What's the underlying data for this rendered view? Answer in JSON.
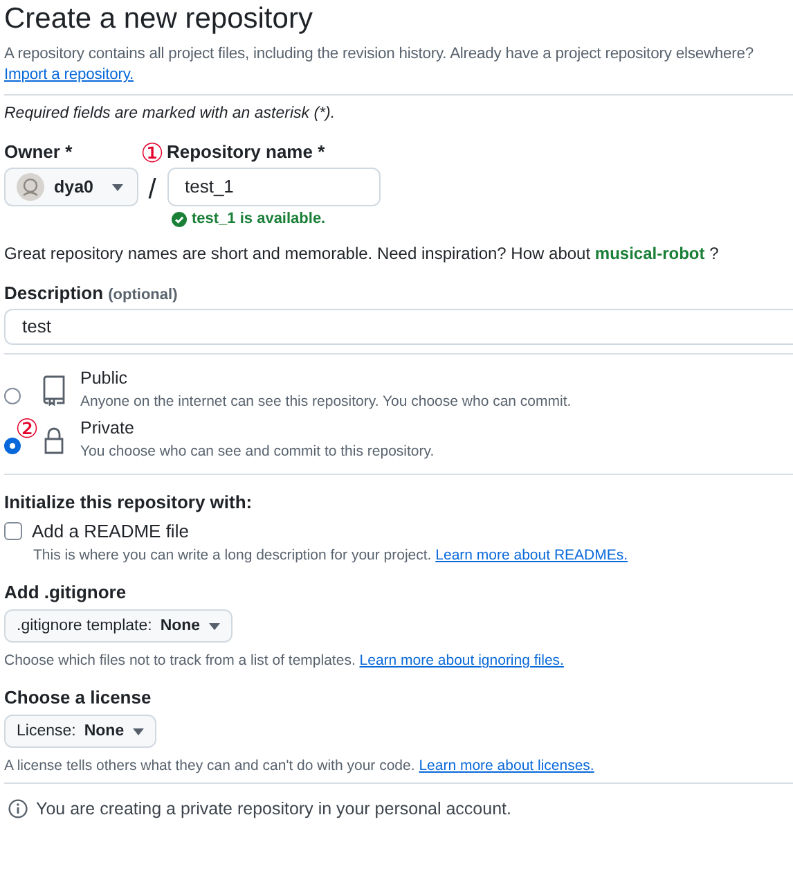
{
  "title": "Create a new repository",
  "intro": {
    "text": "A repository contains all project files, including the revision history. Already have a project repository elsewhere?",
    "link": "Import a repository."
  },
  "required_note": "Required fields are marked with an asterisk (*).",
  "owner": {
    "label": "Owner *",
    "value": "dya0"
  },
  "separator": "/",
  "markers": [
    "①",
    "②"
  ],
  "repo_name": {
    "label": "Repository name *",
    "value": "test_1",
    "status": "test_1 is available."
  },
  "suggestion": {
    "text": "Great repository names are short and memorable. Need inspiration? How about",
    "name": "musical-robot",
    "after": "?"
  },
  "description": {
    "label": "Description",
    "hint": "(optional)",
    "value": "test"
  },
  "visibility": [
    {
      "kind": "public",
      "title": "Public",
      "text": "Anyone on the internet can see this repository. You choose who can commit.",
      "selected": false
    },
    {
      "kind": "private",
      "title": "Private",
      "text": "You choose who can see and commit to this repository.",
      "selected": true
    }
  ],
  "initialize": {
    "heading": "Initialize this repository with:",
    "label": "Add a README file",
    "checked": false,
    "text": "This is where you can write a long description for your project.",
    "link": "Learn more about READMEs."
  },
  "gitignore": {
    "heading": "Add .gitignore",
    "button_label": ".gitignore template:",
    "button_value": "None",
    "text": "Choose which files not to track from a list of templates.",
    "link": "Learn more about ignoring files."
  },
  "license": {
    "heading": "Choose a license",
    "button_label": "License:",
    "button_value": "None",
    "text": "A license tells others what they can and can't do with your code.",
    "link": "Learn more about licenses."
  },
  "notice": "You are creating a private repository in your personal account."
}
